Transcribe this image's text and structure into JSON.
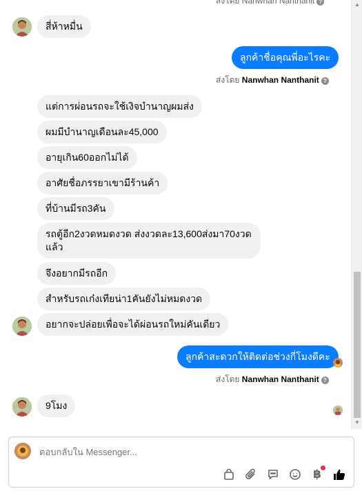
{
  "conversation": {
    "top_cut_text": "ส่งโดย Nanwhan Nanthanit",
    "msg1": "สี่ห้าหมื่น",
    "out1": "ลูกค้าชื่อคุณพี่อะไรคะ",
    "sent_by_prefix": "ส่งโดย",
    "sent_by_name": "Nanwhan Nanthanit",
    "msgs": [
      "แต่การผ่อนรถจะใช้เงิจบำนาญผมส่ง",
      "ผมมีบำนาญเดือนละ45,000",
      "อายุเกิน60ออกไม่ได้",
      "อาศัยชื่อภรรยาเขามีร้านค้า",
      "ที่บ้านมีรถ3คัน",
      "รถตู้อีก2งวดหมดงวด ส่งงวดละ13,600ส่งมา70งวดแล้ว",
      "จึงอยากมีรถอีก",
      "สำหรับรถเก๋งเทียน่า1คันยังไม่หมดงวด",
      "อยากจะปล่อยเพื่อจะได้ผ่อนรถใหม่คันเดียว"
    ],
    "out2": "ลูกค้าสะดวกให้ติดต่อช่วงกี่โมงดีคะ",
    "msg_last": "9โมง"
  },
  "composer": {
    "placeholder": "ตอบกลับใน Messenger..."
  },
  "icons": {
    "info": "info-icon",
    "tools": [
      "bag-icon",
      "attach-icon",
      "chat-icon",
      "emoji-icon",
      "baht-icon",
      "like-icon"
    ]
  },
  "colors": {
    "outgoing": "#0a7cff",
    "incoming": "#f0f0f0",
    "notification_dot": "#f02849"
  }
}
